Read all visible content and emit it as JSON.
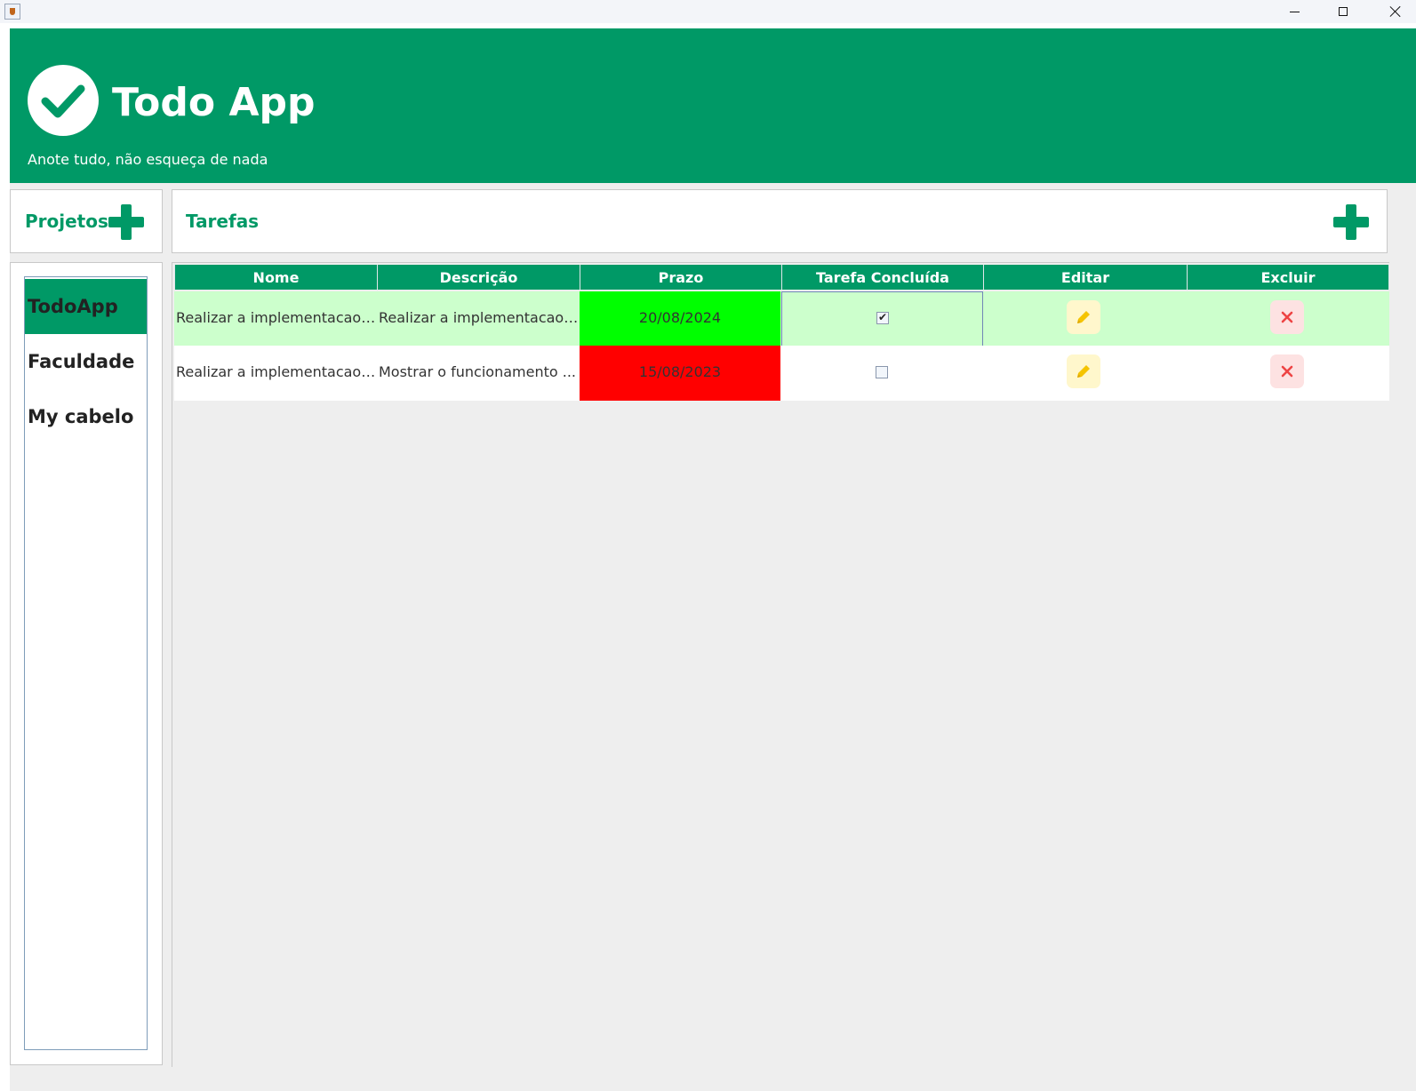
{
  "window": {
    "controls": [
      "minimize",
      "maximize",
      "close"
    ]
  },
  "header": {
    "title": "Todo App",
    "subtitle": "Anote tudo, não esqueça de nada",
    "logo_icon": "checkmark-circle-icon",
    "background": "#009966"
  },
  "projects": {
    "heading": "Projetos",
    "add_icon": "plus-icon",
    "items": [
      {
        "label": "TodoApp",
        "selected": true
      },
      {
        "label": "Faculdade",
        "selected": false
      },
      {
        "label": "My cabelo",
        "selected": false
      }
    ]
  },
  "tasks": {
    "heading": "Tarefas",
    "add_icon": "plus-icon",
    "columns": [
      "Nome",
      "Descrição",
      "Prazo",
      "Tarefa Concluída",
      "Editar",
      "Excluir"
    ],
    "rows": [
      {
        "nome": "Realizar a implementacao d...",
        "descricao": "Realizar a implementacao d...",
        "prazo": "20/08/2024",
        "prazo_color": "#00ff00",
        "concluida": true,
        "edit_icon": "pencil-icon",
        "delete_icon": "close-icon"
      },
      {
        "nome": "Realizar a implementacao n...",
        "descricao": "Mostrar o funcionamento ...",
        "prazo": "15/08/2023",
        "prazo_color": "#ff0000",
        "concluida": false,
        "edit_icon": "pencil-icon",
        "delete_icon": "close-icon"
      }
    ]
  },
  "colors": {
    "accent": "#009966",
    "selected_row": "#ccffcc",
    "edit_button_bg": "#fff7cc",
    "delete_button_bg": "#fde2e2"
  }
}
